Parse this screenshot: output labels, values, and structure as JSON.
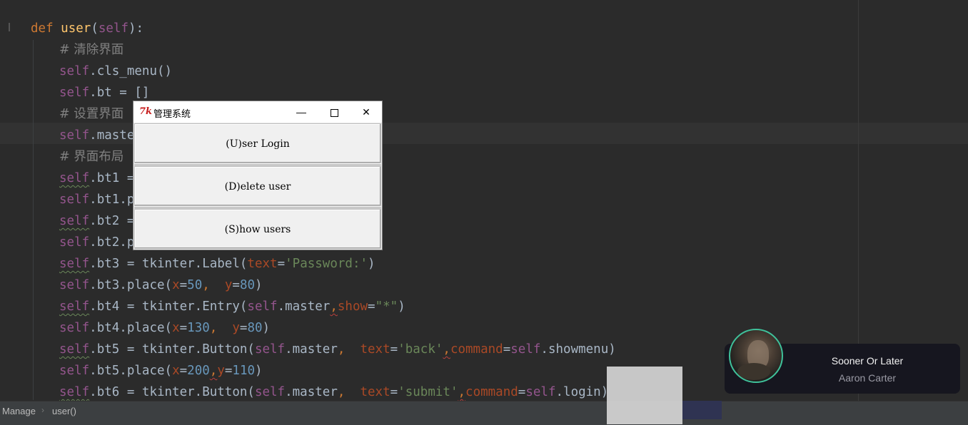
{
  "editor": {
    "lines": [
      [
        {
          "t": "def ",
          "c": "k"
        },
        {
          "t": "user",
          "c": "fn"
        },
        {
          "t": "(",
          "c": ""
        },
        {
          "t": "self",
          "c": "selfp"
        },
        {
          "t": "):",
          "c": ""
        }
      ],
      [
        {
          "t": "# 清除界面",
          "c": "cm"
        }
      ],
      [
        {
          "t": "self",
          "c": "selfp"
        },
        {
          "t": ".cls_menu()",
          "c": ""
        }
      ],
      [
        {
          "t": "self",
          "c": "selfp"
        },
        {
          "t": ".bt = []",
          "c": ""
        }
      ],
      [
        {
          "t": "# 设置界面",
          "c": "cm"
        }
      ],
      [
        {
          "t": "self",
          "c": "selfp"
        },
        {
          "t": ".maste",
          "c": ""
        }
      ],
      [
        {
          "t": "# 界面布局",
          "c": "cm"
        }
      ],
      [
        {
          "t": "self",
          "c": "self"
        },
        {
          "t": ".bt1 =",
          "c": ""
        }
      ],
      [
        {
          "t": "self",
          "c": "selfp"
        },
        {
          "t": ".bt1.p",
          "c": ""
        }
      ],
      [
        {
          "t": "self",
          "c": "self"
        },
        {
          "t": ".bt2 =",
          "c": ""
        }
      ],
      [
        {
          "t": "self",
          "c": "selfp"
        },
        {
          "t": ".bt2.p",
          "c": ""
        }
      ],
      [
        {
          "t": "self",
          "c": "self"
        },
        {
          "t": ".bt3 = tkinter.Label(",
          "c": ""
        },
        {
          "t": "text",
          "c": "kw"
        },
        {
          "t": "=",
          "c": ""
        },
        {
          "t": "'Password:'",
          "c": "str"
        },
        {
          "t": ")",
          "c": ""
        }
      ],
      [
        {
          "t": "self",
          "c": "selfp"
        },
        {
          "t": ".bt3.place(",
          "c": ""
        },
        {
          "t": "x",
          "c": "kw"
        },
        {
          "t": "=",
          "c": ""
        },
        {
          "t": "50",
          "c": "num"
        },
        {
          "t": ",  ",
          "c": "k"
        },
        {
          "t": "y",
          "c": "kw"
        },
        {
          "t": "=",
          "c": ""
        },
        {
          "t": "80",
          "c": "num"
        },
        {
          "t": ")",
          "c": ""
        }
      ],
      [
        {
          "t": "self",
          "c": "self"
        },
        {
          "t": ".bt4 = tkinter.Entry(",
          "c": ""
        },
        {
          "t": "self",
          "c": "selfp"
        },
        {
          "t": ".master",
          "c": ""
        },
        {
          "t": ",",
          "c": "wv"
        },
        {
          "t": "show",
          "c": "kw"
        },
        {
          "t": "=",
          "c": ""
        },
        {
          "t": "\"*\"",
          "c": "str"
        },
        {
          "t": ")",
          "c": ""
        }
      ],
      [
        {
          "t": "self",
          "c": "selfp"
        },
        {
          "t": ".bt4.place(",
          "c": ""
        },
        {
          "t": "x",
          "c": "kw"
        },
        {
          "t": "=",
          "c": ""
        },
        {
          "t": "130",
          "c": "num"
        },
        {
          "t": ",  ",
          "c": "k"
        },
        {
          "t": "y",
          "c": "kw"
        },
        {
          "t": "=",
          "c": ""
        },
        {
          "t": "80",
          "c": "num"
        },
        {
          "t": ")",
          "c": ""
        }
      ],
      [
        {
          "t": "self",
          "c": "self"
        },
        {
          "t": ".bt5 = tkinter.Button(",
          "c": ""
        },
        {
          "t": "self",
          "c": "selfp"
        },
        {
          "t": ".master",
          "c": ""
        },
        {
          "t": ",  ",
          "c": "k"
        },
        {
          "t": "text",
          "c": "kw"
        },
        {
          "t": "=",
          "c": ""
        },
        {
          "t": "'back'",
          "c": "str"
        },
        {
          "t": ",",
          "c": "wv"
        },
        {
          "t": "command",
          "c": "kw"
        },
        {
          "t": "=",
          "c": ""
        },
        {
          "t": "self",
          "c": "selfp"
        },
        {
          "t": ".showmenu)",
          "c": ""
        }
      ],
      [
        {
          "t": "self",
          "c": "selfp"
        },
        {
          "t": ".bt5.place(",
          "c": ""
        },
        {
          "t": "x",
          "c": "kw"
        },
        {
          "t": "=",
          "c": ""
        },
        {
          "t": "200",
          "c": "num"
        },
        {
          "t": ",",
          "c": "wv"
        },
        {
          "t": "y",
          "c": "kw"
        },
        {
          "t": "=",
          "c": ""
        },
        {
          "t": "110",
          "c": "num"
        },
        {
          "t": ")",
          "c": ""
        }
      ],
      [
        {
          "t": "self",
          "c": "self"
        },
        {
          "t": ".bt6 = tkinter.Button(",
          "c": ""
        },
        {
          "t": "self",
          "c": "selfp"
        },
        {
          "t": ".master",
          "c": ""
        },
        {
          "t": ",  ",
          "c": "k"
        },
        {
          "t": "text",
          "c": "kw"
        },
        {
          "t": "=",
          "c": ""
        },
        {
          "t": "'submit'",
          "c": "str"
        },
        {
          "t": ",",
          "c": "wv"
        },
        {
          "t": "command",
          "c": "kw"
        },
        {
          "t": "=",
          "c": ""
        },
        {
          "t": "self",
          "c": "selfp"
        },
        {
          "t": ".login)",
          "c": ""
        }
      ]
    ]
  },
  "statusbar": {
    "crumb1": "Manage",
    "sep": "›",
    "crumb2": "user()"
  },
  "tk_window": {
    "icon": "7k",
    "title": "管理系统",
    "min": "—",
    "close": "✕",
    "buttons": [
      "(U)ser Login",
      "(D)elete user",
      "(S)how users"
    ]
  },
  "music": {
    "title": "Sooner Or Later",
    "artist": "Aaron Carter"
  },
  "colors": {
    "editor_bg": "#2b2b2b",
    "keyword": "#cc7832",
    "function": "#ffc66d",
    "self": "#94558d",
    "string": "#6a8759",
    "number": "#6897bb",
    "comment": "#808080",
    "accent_ring": "#3fc19a"
  }
}
